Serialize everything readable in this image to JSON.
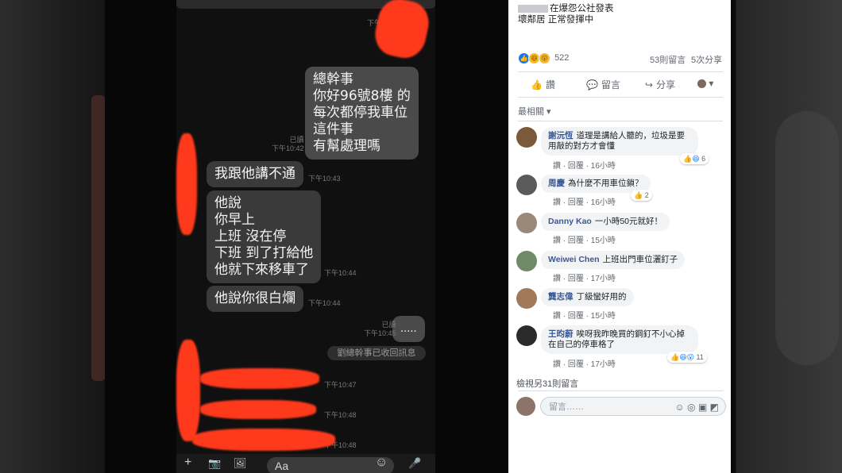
{
  "chat": {
    "messages": [
      {
        "text": "總幹事\n你好96號8樓 的\n每次都停我車位\n這件事\n有幫處理嗎",
        "meta": "已讀\n下午10:42"
      },
      {
        "text": "我跟他講不通",
        "meta": "下午10:43"
      },
      {
        "text": "他說\n你早上\n上班 沒在停\n下班 到了打給他\n他就下來移車了",
        "meta": "下午10:44"
      },
      {
        "text": "他說你很白爛",
        "meta": "下午10:44"
      },
      {
        "text": ".....",
        "meta": "已讀\n下午10:45"
      }
    ],
    "recall_notice": "劉總幹事已收回訊息",
    "redacted_times": [
      "下午10:47",
      "下午10:48",
      "下午10:48"
    ],
    "top_time": "下午",
    "input_placeholder": "Aa",
    "icons": {
      "plus": "+",
      "camera": "📷",
      "image": "🖼",
      "emoji": "☺",
      "mic": "🎤"
    }
  },
  "post": {
    "author_suffix": "在爆怨公社發表",
    "body": "壞鄰居 正常發揮中",
    "reaction_count": "522",
    "comments_count": "53則留言",
    "shares_count": "5次分享",
    "actions": {
      "like": "讚",
      "comment": "留言",
      "share": "分享"
    },
    "sort": "最相關 ▾",
    "view_more": "檢視另31則留言",
    "reply_placeholder": "留言……"
  },
  "comments": [
    {
      "name": "謝沅恆",
      "text": "道理是講給人聽的，垃圾是要用敲的對方才會懂",
      "like": "讚",
      "reply": "回覆",
      "time": "16小時",
      "reactions": "6"
    },
    {
      "name": "周慶",
      "text": "為什麼不用車位鎖？",
      "like": "讚",
      "reply": "回覆",
      "time": "16小時",
      "reactions": "2"
    },
    {
      "name": "Danny Kao",
      "text": "一小時50元就好！",
      "like": "讚",
      "reply": "回覆",
      "time": "15小時",
      "reactions": ""
    },
    {
      "name": "Weiwei Chen",
      "text": "上班出門車位灑釘子",
      "like": "讚",
      "reply": "回覆",
      "time": "17小時",
      "reactions": ""
    },
    {
      "name": "龔志偉",
      "text": "丁級蠻好用的",
      "like": "讚",
      "reply": "回覆",
      "time": "15小時",
      "reactions": ""
    },
    {
      "name": "王昀蔚",
      "text": "唉呀我昨晚買的鋼釘不小心掉在自己的停車格了",
      "like": "讚",
      "reply": "回覆",
      "time": "17小時",
      "reactions": "11"
    }
  ],
  "colors": {
    "redaction": "#ff3a1c",
    "fb_link": "#385898",
    "fb_blue": "#1877f2"
  }
}
